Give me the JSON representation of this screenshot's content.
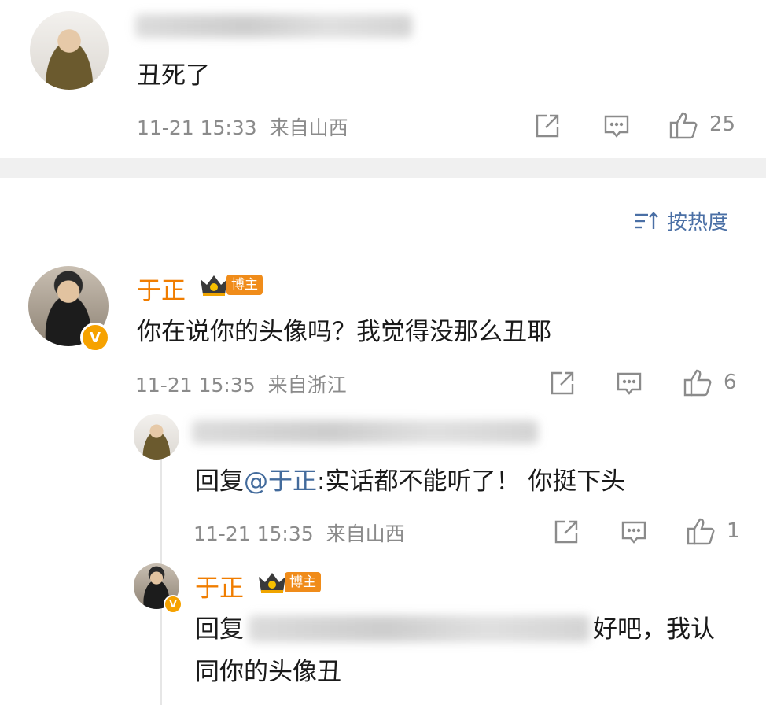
{
  "comment1": {
    "text": "丑死了",
    "time": "11-21 15:33",
    "location": "来自山西",
    "likes": "25"
  },
  "sort": {
    "label": "按热度"
  },
  "comment2": {
    "username": "于正",
    "badge": "博主",
    "text": "你在说你的头像吗？我觉得没那么丑耶",
    "time": "11-21 15:35",
    "location": "来自浙江",
    "likes": "6"
  },
  "reply1": {
    "prefix": "回复",
    "mention": "@于正",
    "text": ":实话都不能听了！ 你挺下头",
    "time": "11-21 15:35",
    "location": "来自山西",
    "likes": "1"
  },
  "reply2": {
    "username": "于正",
    "badge": "博主",
    "prefix": "回复",
    "text_line1": "好吧，我认",
    "text_line2": "同你的头像丑"
  },
  "icons": {
    "share": "share-icon",
    "comment": "comment-icon",
    "like": "thumbs-up-icon",
    "sort": "sort-icon",
    "crown": "crown-icon",
    "verified": "verified-v-icon"
  },
  "colors": {
    "username": "#f07d00",
    "mention": "#436b9c",
    "meta": "#8b8b8b",
    "badge": "#f08c1a"
  }
}
